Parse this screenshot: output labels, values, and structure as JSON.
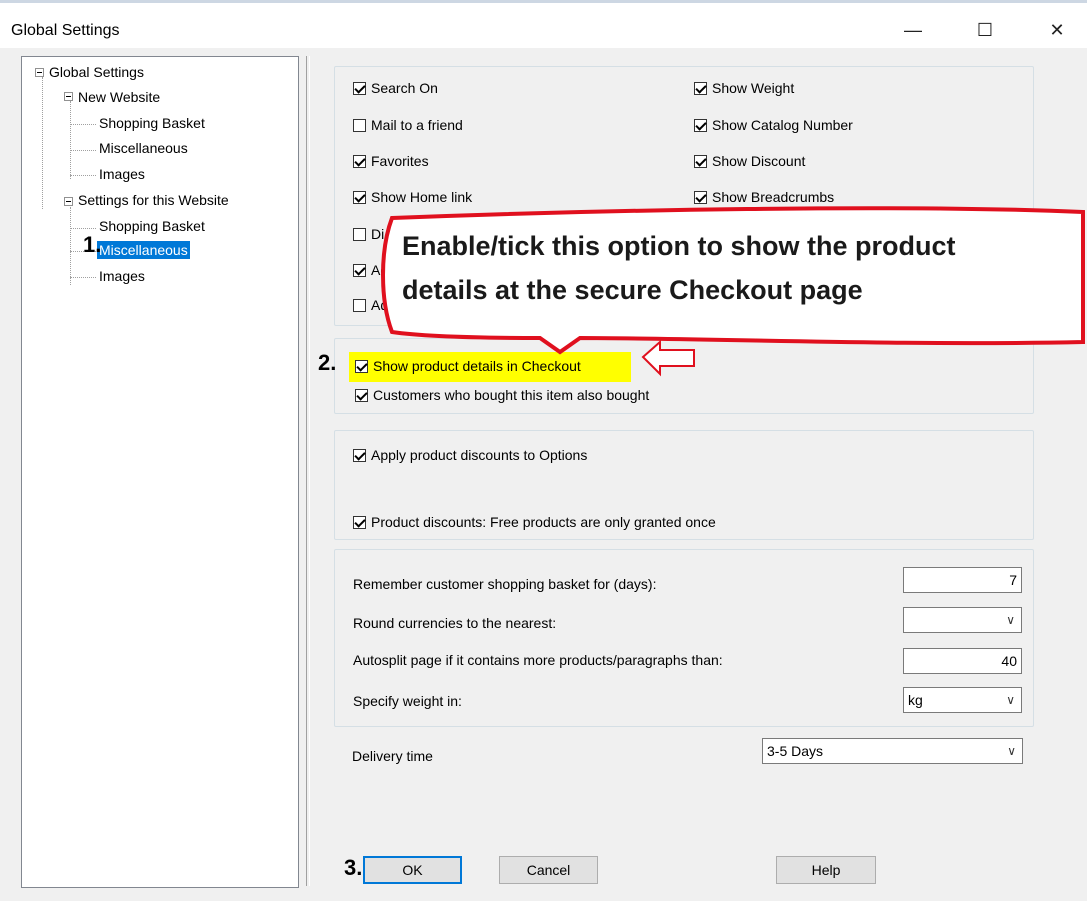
{
  "window": {
    "title": "Global Settings",
    "controls": {
      "minimize": "—",
      "maximize": "☐",
      "close": "✕"
    }
  },
  "tree": {
    "root": "Global Settings",
    "new_website": "New Website",
    "new_items": [
      "Shopping Basket",
      "Miscellaneous",
      "Images"
    ],
    "this_website": "Settings for this Website",
    "this_items": [
      "Shopping Basket",
      "Miscellaneous",
      "Images"
    ]
  },
  "options_group1": {
    "left": [
      {
        "label": "Search On",
        "checked": true
      },
      {
        "label": "Mail to a friend",
        "checked": false
      },
      {
        "label": "Favorites",
        "checked": true
      },
      {
        "label": "Show Home link",
        "checked": true
      },
      {
        "label": "Di",
        "checked": false
      },
      {
        "label": "Ad",
        "checked": true
      },
      {
        "label": "Ad",
        "checked": false
      }
    ],
    "right": [
      {
        "label": "Show Weight",
        "checked": true
      },
      {
        "label": "Show Catalog Number",
        "checked": true
      },
      {
        "label": "Show Discount",
        "checked": true
      },
      {
        "label": "Show Breadcrumbs",
        "checked": true
      }
    ]
  },
  "options_group2": {
    "show_product_details": {
      "label": "Show product details in Checkout",
      "checked": true
    },
    "customers_bought": {
      "label": "Customers who bought this item also bought",
      "checked": true
    }
  },
  "options_group3": {
    "apply_discounts": {
      "label": "Apply product discounts to Options",
      "checked": true
    },
    "free_products_once": {
      "label": "Product discounts: Free products are only granted once",
      "checked": true
    }
  },
  "settings": {
    "remember_label": "Remember customer shopping basket for (days):",
    "remember_value": "7",
    "round_label": "Round currencies to the nearest:",
    "round_value": "",
    "autosplit_label": "Autosplit page if it contains more products/paragraphs than:",
    "autosplit_value": "40",
    "weight_label": "Specify weight in:",
    "weight_value": "kg"
  },
  "delivery": {
    "label": "Delivery time",
    "value": "3-5 Days"
  },
  "buttons": {
    "ok": "OK",
    "cancel": "Cancel",
    "help": "Help"
  },
  "annotations": {
    "step1": "1.",
    "step2": "2.",
    "step3": "3.",
    "callout_line1": "Enable/tick this option to show the product",
    "callout_line2": "details at the secure Checkout page",
    "colors": {
      "callout_border": "#e0101e",
      "highlight": "#ffff00",
      "arrow": "#e0101e"
    }
  }
}
